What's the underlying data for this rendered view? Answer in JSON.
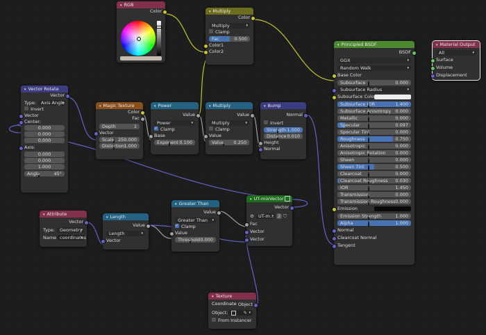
{
  "colors": {
    "input_header": "#83314a",
    "converter_header": "#246283",
    "texture_header": "#8a4f1a",
    "vector_header": "#3c3c83",
    "shader_header": "#4b8a2e",
    "output_header": "#83314a",
    "color_header": "#6d6d1d",
    "group_header": "#1d6d1d",
    "yellow_socket": "#c7c729",
    "purple_socket": "#6363c7",
    "grey_socket": "#a1a1a1",
    "green_socket": "#63c763",
    "field_blue": "#4772b3"
  },
  "rgb": {
    "title": "RGB",
    "out": "Color"
  },
  "multiply_top": {
    "title": "Multiply",
    "out": "Color",
    "mode": "Multiply",
    "clamp": "Clamp",
    "fac_label": "Fac",
    "fac_value": "0.500",
    "fac_fraction": 0.5,
    "in1": "Color1",
    "in2": "Color2"
  },
  "vector_rotate": {
    "title": "Vector Rotate",
    "out": "Vector",
    "type_label": "Type:",
    "type_value": "Axis Angle",
    "invert": "Invert",
    "vector": "Vector",
    "center": "Center:",
    "c1": "0.000",
    "c2": "0.000",
    "c3": "0.000",
    "axis": "Axis:",
    "a1": "0.000",
    "a2": "0.000",
    "a3": "1.000",
    "angle_label": "Angle",
    "angle_value": "45°"
  },
  "magic": {
    "title": "Magic Texture",
    "out1": "Color",
    "out2": "Fac",
    "depth_label": "Depth",
    "depth_value": "1",
    "vector": "Vector",
    "scale_label": "Scale",
    "scale_value": "250.000",
    "dist_label": "Distortion",
    "dist_value": "1.000"
  },
  "power": {
    "title": "Power",
    "out": "Value",
    "mode": "Power",
    "clamp": "Clamp",
    "base": "Base",
    "exp_label": "Exponent",
    "exp_value": "0.100"
  },
  "multiply_mid": {
    "title": "Multiply",
    "out": "Value",
    "mode": "Multiply",
    "clamp": "Clamp",
    "in1": "Value",
    "val_label": "Value",
    "val_value": "0.250"
  },
  "bump": {
    "title": "Bump",
    "out": "Normal",
    "invert": "Invert",
    "str_label": "Strength",
    "str_value": "1.000",
    "dist_label": "Distance",
    "dist_value": "0.010",
    "height": "Height",
    "normal": "Normal"
  },
  "bsdf": {
    "title": "Principled BSDF",
    "out": "BSDF",
    "dist": "GGX",
    "sss": "Random Walk",
    "base_color": "Base Color",
    "rows": [
      {
        "label": "Subsurface",
        "value": "0.000",
        "fill": 0
      },
      {
        "label": "Subsurface Radius",
        "value": "",
        "fill": 0,
        "drop": true
      },
      {
        "label": "Subsurface Colo",
        "value": "",
        "fill": 0,
        "swatch": "#ededed"
      },
      {
        "label": "Subsurface IOR",
        "value": "1.400",
        "fill": 1
      },
      {
        "label": "Subsurface Anisotropy",
        "value": "0.000",
        "fill": 0
      },
      {
        "label": "Metallic",
        "value": "0.000",
        "fill": 0
      },
      {
        "label": "Specular",
        "value": "0.097",
        "fill": 0.1
      },
      {
        "label": "Specular Tint",
        "value": "0.000",
        "fill": 0
      },
      {
        "label": "Roughness",
        "value": "0.750",
        "fill": 0.75
      },
      {
        "label": "Anisotropic",
        "value": "0.000",
        "fill": 0
      },
      {
        "label": "Anisotropic Rotation",
        "value": "0.000",
        "fill": 0
      },
      {
        "label": "Sheen",
        "value": "0.000",
        "fill": 0
      },
      {
        "label": "Sheen Tint",
        "value": "0.500",
        "fill": 0.5
      },
      {
        "label": "Clearcoat",
        "value": "0.000",
        "fill": 0
      },
      {
        "label": "Clearcoat Roughness",
        "value": "0.030",
        "fill": 0.03
      },
      {
        "label": "IOR",
        "value": "1.450",
        "fill": 0
      },
      {
        "label": "Transmission",
        "value": "0.000",
        "fill": 0
      },
      {
        "label": "Transmission Roughness",
        "value": "0.000",
        "fill": 0
      },
      {
        "label": "Emission",
        "value": "",
        "fill": 0,
        "swatch": "#0a0a0a"
      },
      {
        "label": "Emission Strength",
        "value": "1.000",
        "fill": 0
      },
      {
        "label": "Alpha",
        "value": "1.000",
        "fill": 1
      }
    ],
    "normal": "Normal",
    "clearcoat_normal": "Clearcoat Normal",
    "tangent": "Tangent"
  },
  "output": {
    "title": "Material Output",
    "target": "All",
    "surface": "Surface",
    "volume": "Volume",
    "displacement": "Displacement"
  },
  "attribute": {
    "title": "Attribute",
    "out": "Vector",
    "type_label": "Type:",
    "type_value": "Geometry",
    "name_label": "Name:",
    "name_value": "coordinates"
  },
  "length": {
    "title": "Length",
    "out": "Value",
    "mode": "Length",
    "vector": "Vector"
  },
  "greater": {
    "title": "Greater Than",
    "out": "Value",
    "mode": "Greater Than",
    "clamp": "Clamp",
    "value": "Value",
    "thr_label": "Threshold",
    "thr_value": "0.000"
  },
  "group": {
    "title": "UT-mixVector",
    "out": "Vector",
    "name": "UT-m...",
    "users": "2",
    "fac": "Fac",
    "vec1": "Vector",
    "vec2": "Vector"
  },
  "texcoord": {
    "title": "Texture Coordinate",
    "out": "Object",
    "object_label": "Object:",
    "instancer": "From Instancer"
  }
}
